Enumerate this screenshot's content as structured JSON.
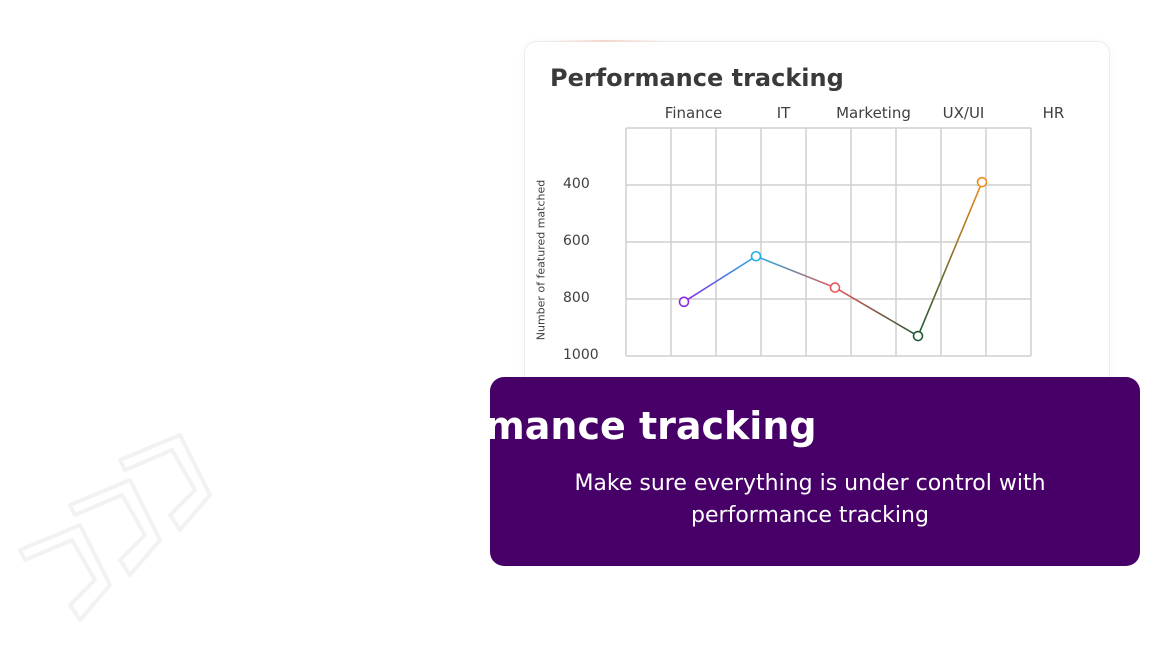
{
  "chart_data": {
    "type": "line",
    "title": "Performance tracking",
    "categories": [
      "Finance",
      "IT",
      "Marketing",
      "UX/UI",
      "HR"
    ],
    "ylabel": "Number of featured matched",
    "yticks": [
      "400",
      "600",
      "800",
      "1000"
    ],
    "y_inverted": true,
    "ylim": [
      200,
      1000
    ],
    "grid": true,
    "values": [
      810,
      650,
      760,
      930,
      390
    ],
    "point_colors": [
      "#8a2be2",
      "#1fb0e8",
      "#e85a5a",
      "#1f5a36",
      "#f08a1c"
    ]
  },
  "banner": {
    "title": "Performance tracking",
    "subtitle": "Make sure everything is under control with performance tracking"
  },
  "colors": {
    "banner_bg": "#470068",
    "grid": "#cfcfcf"
  }
}
